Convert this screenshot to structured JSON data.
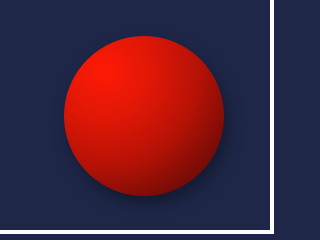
{
  "scene": {
    "background_color": "#1e2748",
    "edge_color": "#ffffff",
    "ball": {
      "color_highlight": "#ff1a05",
      "color_mid": "#b51206",
      "color_shadow": "#3a0805"
    }
  }
}
